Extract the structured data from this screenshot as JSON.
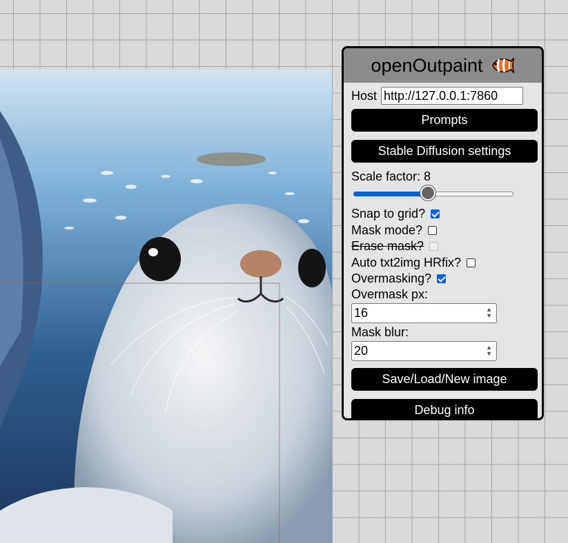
{
  "panel": {
    "title": "openOutpaint",
    "host_label": "Host",
    "host_value": "http://127.0.0.1:7860",
    "prompts_button": "Prompts",
    "sd_settings_button": "Stable Diffusion settings",
    "scale_factor_label": "Scale factor: 8",
    "scale_factor": {
      "value": 8,
      "fraction": 0.47
    },
    "snap_to_grid": {
      "label": "Snap to grid?",
      "checked": true
    },
    "mask_mode": {
      "label": "Mask mode?",
      "checked": false
    },
    "erase_mask": {
      "label": "Erase mask?",
      "checked": false,
      "disabled": true
    },
    "auto_hrfix": {
      "label": "Auto txt2img HRfix?",
      "checked": false
    },
    "overmasking": {
      "label": "Overmasking?",
      "checked": true
    },
    "overmask_px_label": "Overmask px:",
    "overmask_px_value": "16",
    "mask_blur_label": "Mask blur:",
    "mask_blur_value": "20",
    "save_load_button": "Save/Load/New image",
    "debug_button": "Debug info"
  },
  "icons": {
    "spin_up": "▲",
    "spin_down": "▼"
  },
  "colors": {
    "accent": "#0a62d0",
    "panel_bg": "#e5e5e5",
    "header_bg": "#8c8c8c",
    "grid_bg": "#d9d9d9"
  }
}
